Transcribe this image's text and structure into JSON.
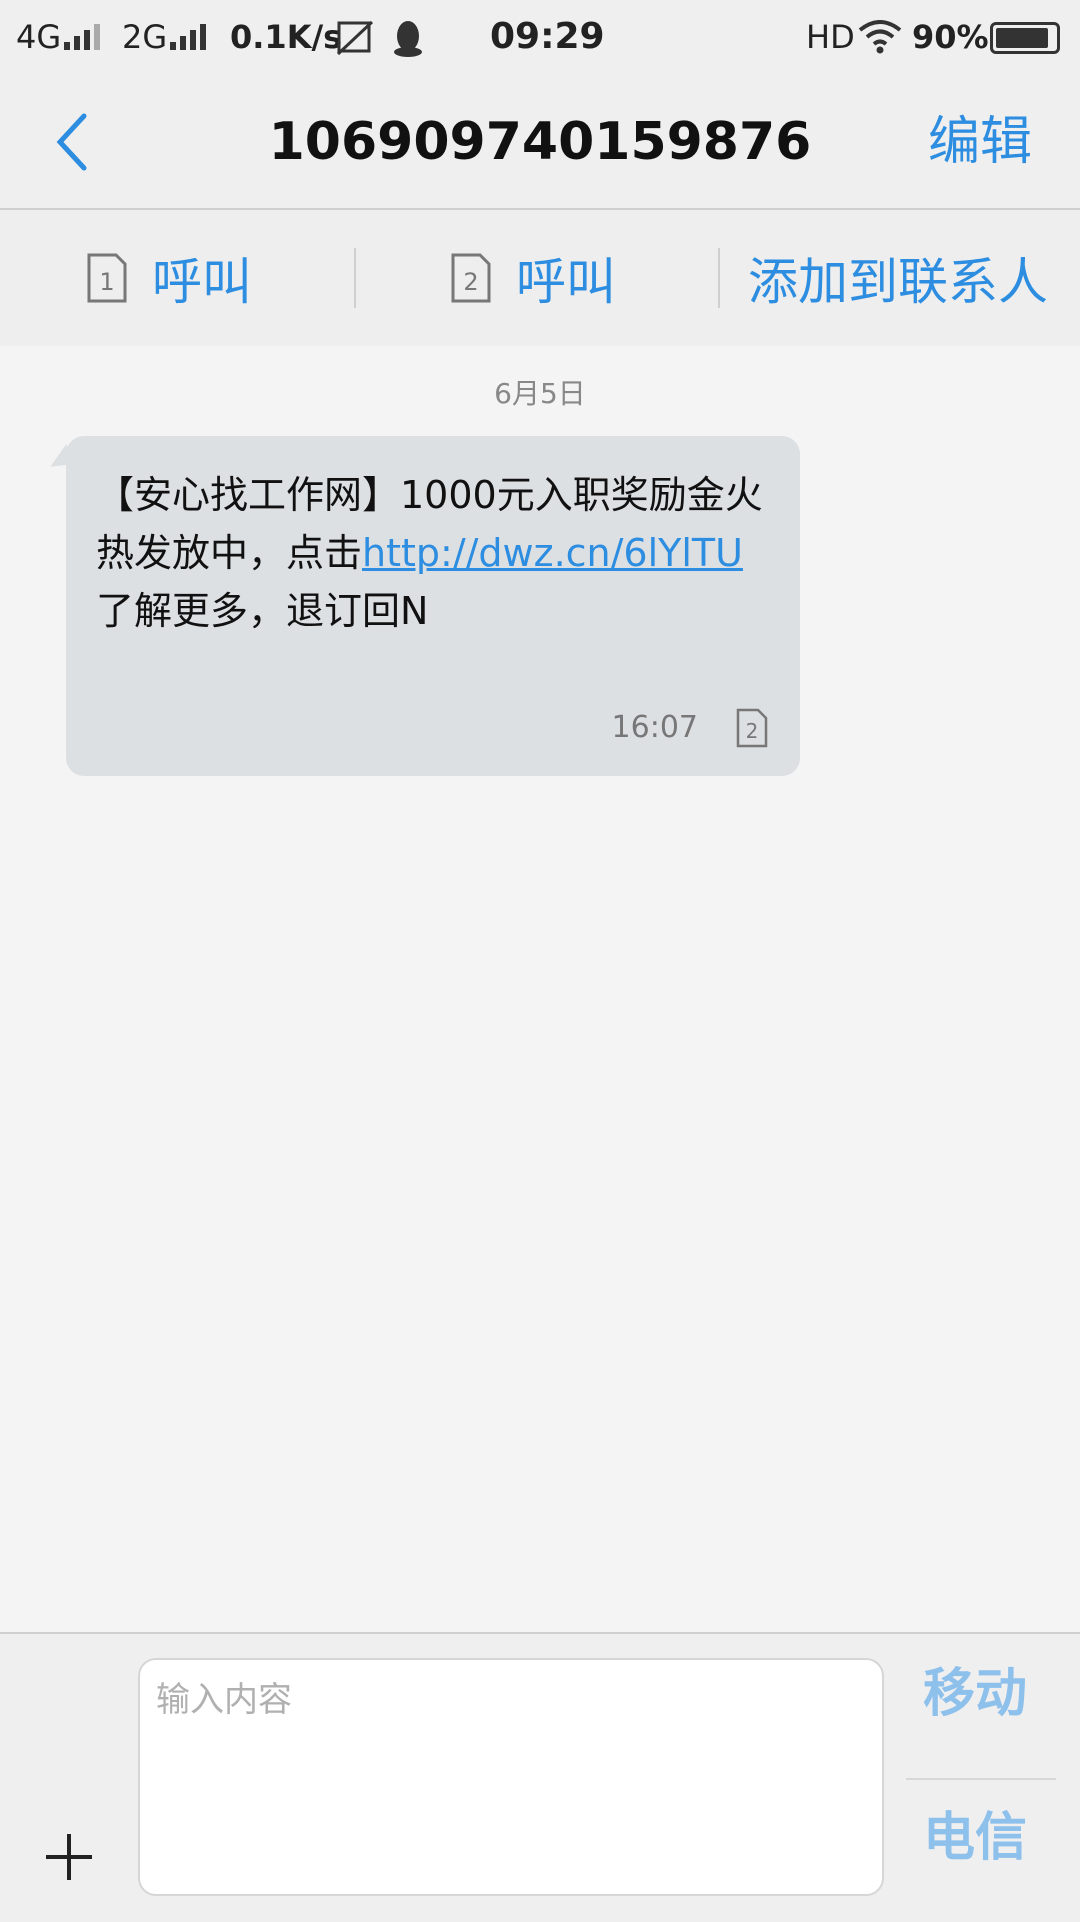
{
  "status_bar": {
    "sim1_network": "4G",
    "sim2_network": "2G",
    "speed": "0.1K/s",
    "time": "09:29",
    "hd": "HD",
    "battery_percent": "90%",
    "battery_level": 0.9
  },
  "header": {
    "title": "106909740159876",
    "edit_label": "编辑"
  },
  "actions": {
    "call_sim1_label": "呼叫",
    "call_sim2_label": "呼叫",
    "sim1_number": "1",
    "sim2_number": "2",
    "add_contact_label": "添加到联系人"
  },
  "conversation": {
    "date_label": "6月5日",
    "message": {
      "text_part1": "【安心找工作网】1000元入职奖励金火热发放中，点击",
      "link": "http://dwz.cn/6lYlTU",
      "text_part2": " 了解更多，退订回N",
      "time": "16:07",
      "sim": "2"
    }
  },
  "composer": {
    "placeholder": "输入内容",
    "send_sim1_label": "移动",
    "send_sim2_label": "电信"
  },
  "colors": {
    "accent": "#2d8de0",
    "bubble": "#dde0e3",
    "send_disabled": "#8ec0ec"
  }
}
